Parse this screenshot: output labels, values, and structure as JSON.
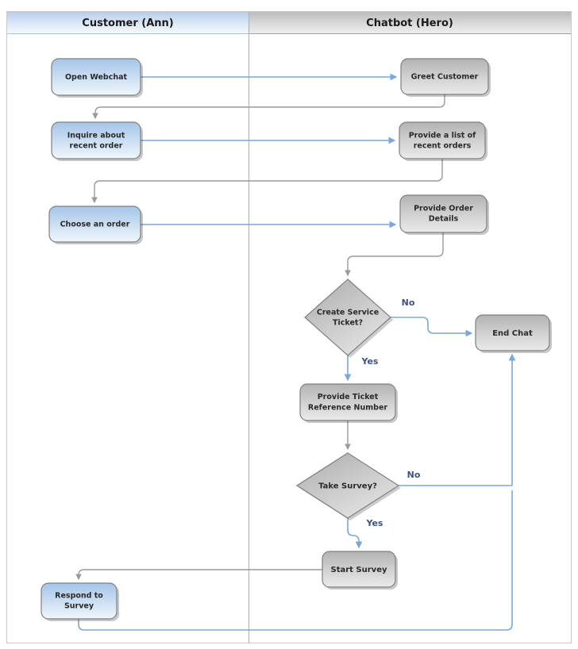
{
  "diagram": {
    "type": "swimlane-flowchart",
    "lanes": [
      {
        "id": "customer",
        "title": "Customer (Ann)",
        "fill_top": "#b9d0ea",
        "fill_bottom": "#f2f7fc"
      },
      {
        "id": "chatbot",
        "title": "Chatbot (Hero)",
        "fill_top": "#bdbdbd",
        "fill_bottom": "#ececec"
      }
    ],
    "colors": {
      "customer_node_top": "#a8c6e8",
      "customer_node_bottom": "#eef5fc",
      "customer_node_border": "#7d7d7d",
      "chatbot_node_top": "#b4b4b4",
      "chatbot_node_bottom": "#e8e8e8",
      "chatbot_node_border": "#7d7d7d",
      "decision_top": "#b4b4b4",
      "decision_bottom": "#e2e2e2",
      "connector_gray": "#9a9a9a",
      "connector_blue": "#7ba7dd",
      "label_blue": "#3b5282",
      "lane_divider": "#b0b0b0",
      "outer_border": "#c8c8c8"
    },
    "nodes": [
      {
        "id": "open-webchat",
        "label_lines": [
          "Open Webchat"
        ],
        "lane": "customer",
        "shape": "rounded-rect"
      },
      {
        "id": "greet-customer",
        "label_lines": [
          "Greet Customer"
        ],
        "lane": "chatbot",
        "shape": "rounded-rect"
      },
      {
        "id": "inquire-recent-order",
        "label_lines": [
          "Inquire about",
          "recent order"
        ],
        "lane": "customer",
        "shape": "rounded-rect"
      },
      {
        "id": "provide-list-recent-orders",
        "label_lines": [
          "Provide a list of",
          "recent orders"
        ],
        "lane": "chatbot",
        "shape": "rounded-rect"
      },
      {
        "id": "choose-an-order",
        "label_lines": [
          "Choose an order"
        ],
        "lane": "customer",
        "shape": "rounded-rect"
      },
      {
        "id": "provide-order-details",
        "label_lines": [
          "Provide Order",
          "Details"
        ],
        "lane": "chatbot",
        "shape": "rounded-rect"
      },
      {
        "id": "create-service-ticket",
        "label_lines": [
          "Create Service",
          "Ticket?"
        ],
        "lane": "chatbot",
        "shape": "diamond"
      },
      {
        "id": "end-chat",
        "label_lines": [
          "End Chat"
        ],
        "lane": "chatbot",
        "shape": "rounded-rect"
      },
      {
        "id": "provide-ticket-reference-number",
        "label_lines": [
          "Provide Ticket",
          "Reference Number"
        ],
        "lane": "chatbot",
        "shape": "rounded-rect"
      },
      {
        "id": "take-survey",
        "label_lines": [
          "Take Survey?"
        ],
        "lane": "chatbot",
        "shape": "diamond"
      },
      {
        "id": "start-survey",
        "label_lines": [
          "Start Survey"
        ],
        "lane": "chatbot",
        "shape": "rounded-rect"
      },
      {
        "id": "respond-to-survey",
        "label_lines": [
          "Respond to",
          "Survey"
        ],
        "lane": "customer",
        "shape": "rounded-rect"
      }
    ],
    "edge_labels": [
      {
        "id": "ticket-no",
        "text": "No"
      },
      {
        "id": "ticket-yes",
        "text": "Yes"
      },
      {
        "id": "survey-no",
        "text": "No"
      },
      {
        "id": "survey-yes",
        "text": "Yes"
      }
    ]
  }
}
